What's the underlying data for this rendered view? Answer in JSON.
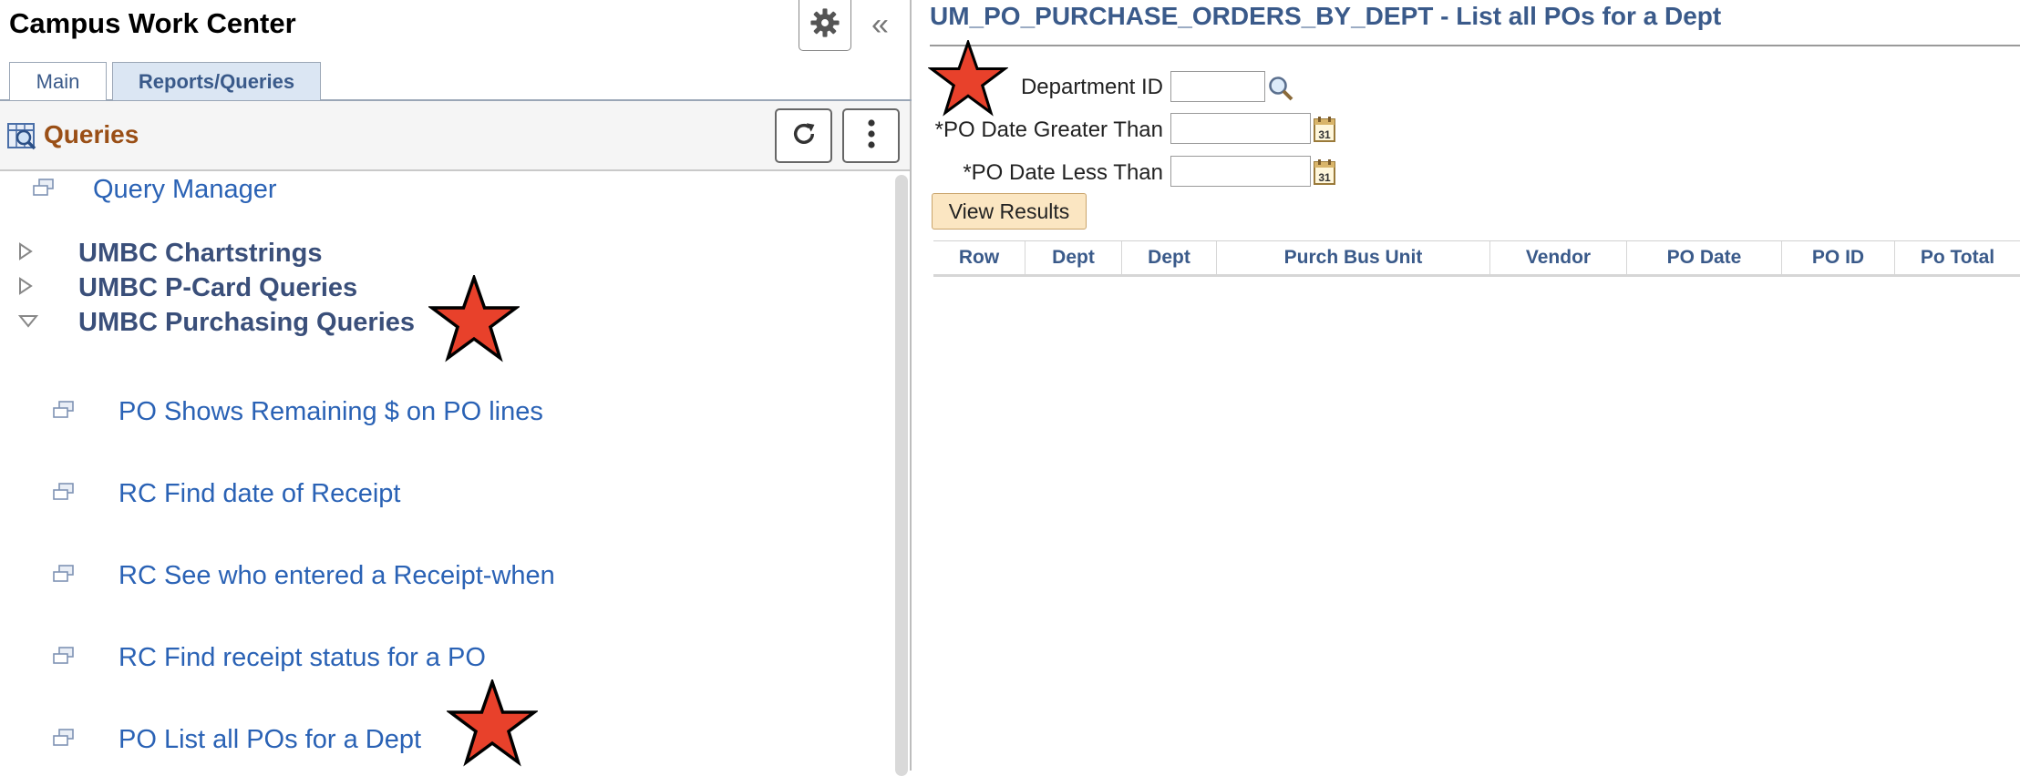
{
  "work_center": {
    "title": "Campus Work Center",
    "tabs": [
      {
        "label": "Main",
        "active": false
      },
      {
        "label": "Reports/Queries",
        "active": true
      }
    ]
  },
  "queries_panel": {
    "title": "Queries",
    "items": [
      {
        "type": "link",
        "label": "Query Manager"
      },
      {
        "type": "folder",
        "label": "UMBC Chartstrings",
        "expanded": false
      },
      {
        "type": "folder",
        "label": "UMBC P-Card Queries",
        "expanded": false
      },
      {
        "type": "folder",
        "label": "UMBC Purchasing Queries",
        "expanded": true
      },
      {
        "type": "link",
        "label": "PO Shows Remaining $ on PO lines"
      },
      {
        "type": "link",
        "label": "RC Find date of Receipt"
      },
      {
        "type": "link",
        "label": "RC See who entered a Receipt-when"
      },
      {
        "type": "link",
        "label": "RC Find receipt status for a PO"
      },
      {
        "type": "link",
        "label": "PO List all POs for a Dept"
      }
    ]
  },
  "report": {
    "title": "UM_PO_PURCHASE_ORDERS_BY_DEPT - List all POs for a Dept",
    "fields": [
      {
        "label": "Department ID",
        "value": "",
        "icon": "search-icon"
      },
      {
        "label": "*PO Date Greater Than",
        "value": "",
        "icon": "calendar-icon"
      },
      {
        "label": "*PO Date Less Than",
        "value": "",
        "icon": "calendar-icon"
      }
    ],
    "view_results_label": "View Results",
    "columns": [
      "Row",
      "Dept",
      "Dept",
      "Purch Bus Unit",
      "Vendor",
      "PO Date",
      "PO ID",
      "Po Total"
    ]
  },
  "colors": {
    "link": "#2a62b5",
    "folder": "#3a4f7a",
    "queries_title": "#9a4f16",
    "heading": "#3a5a8a",
    "star_fill": "#e8412b",
    "button_bg": "#fbe6c2"
  }
}
